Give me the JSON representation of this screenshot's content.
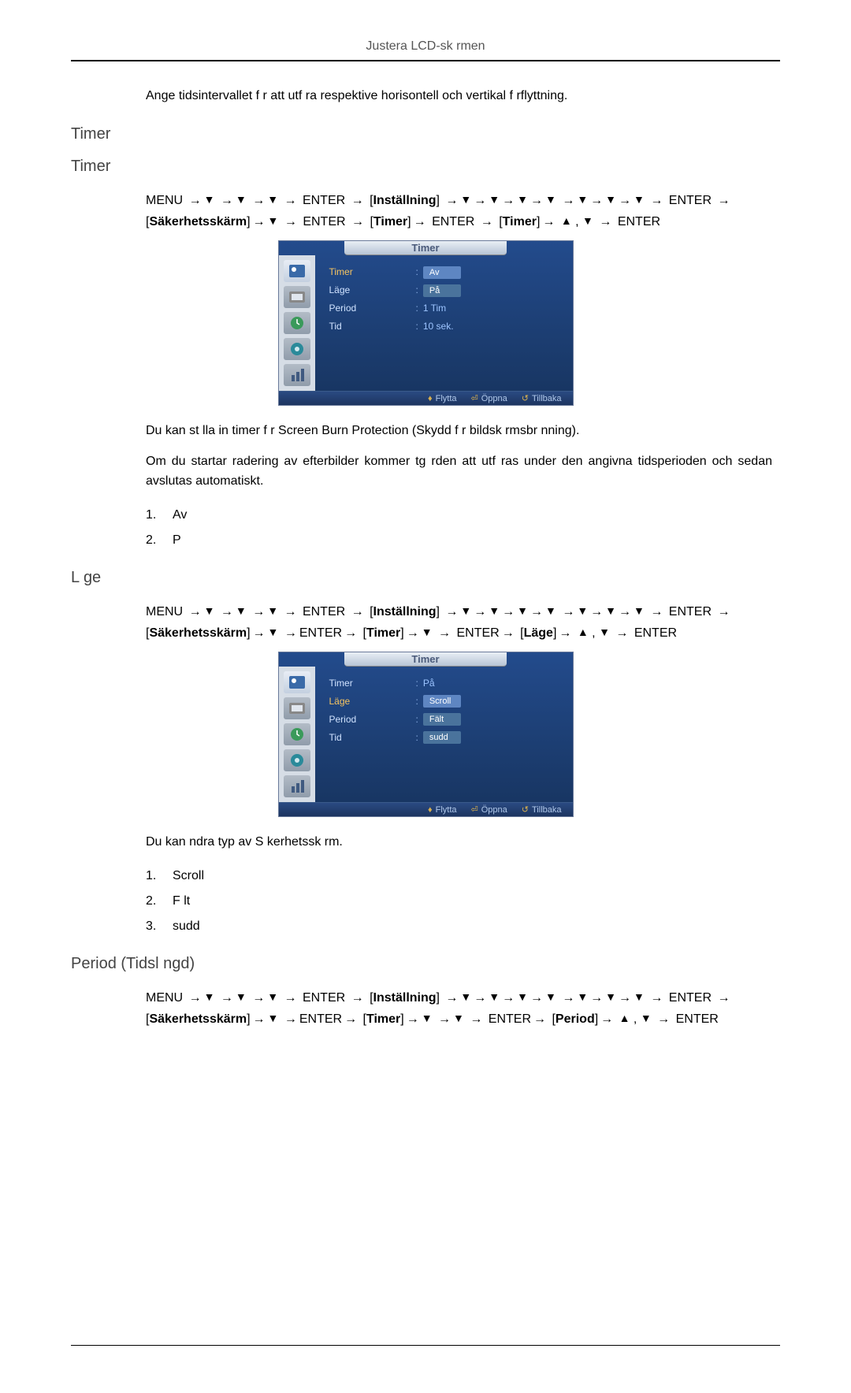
{
  "header": {
    "title": "Justera LCD-sk rmen"
  },
  "intro": "Ange tidsintervallet f r att utf ra respektive horisontell och vertikal f rflyttning.",
  "sections": {
    "timer_outer": "Timer",
    "timer_inner": "Timer",
    "lage": "L ge",
    "period": "Period (Tidsl ngd)"
  },
  "nav": {
    "menu": "MENU",
    "enter": "ENTER",
    "installning": "Inställning",
    "sakerhetsskarm": "Säkerhetsskärm",
    "timer_br": "Timer",
    "lage_br": "Läge",
    "period_br": "Period"
  },
  "osd_timer": {
    "title": "Timer",
    "rows": {
      "timer": "Timer",
      "lage": "Läge",
      "period": "Period",
      "tid": "Tid"
    },
    "vals": {
      "av": "Av",
      "pa": "På",
      "period": "1 Tim",
      "tid": "10 sek."
    },
    "footer": {
      "flytta": "Flytta",
      "oppna": "Öppna",
      "tillbaka": "Tillbaka"
    }
  },
  "osd_lage": {
    "title": "Timer",
    "rows": {
      "timer": "Timer",
      "lage": "Läge",
      "period": "Period",
      "tid": "Tid"
    },
    "vals": {
      "timer": "På",
      "scroll": "Scroll",
      "falt": "Fält",
      "sudd": "sudd"
    },
    "footer": {
      "flytta": "Flytta",
      "oppna": "Öppna",
      "tillbaka": "Tillbaka"
    }
  },
  "text": {
    "timer_desc1": "Du kan st lla in timer f r Screen Burn Protection (Skydd f r bildsk rmsbr nning).",
    "timer_desc2": "Om du startar radering av efterbilder kommer  tg rden att utf ras under den angivna tidsperioden och sedan avslutas automatiskt.",
    "lage_desc": "Du kan  ndra typ av S kerhetssk rm."
  },
  "list_timer": [
    {
      "n": "1.",
      "v": "Av"
    },
    {
      "n": "2.",
      "v": "P"
    }
  ],
  "list_lage": [
    {
      "n": "1.",
      "v": "Scroll"
    },
    {
      "n": "2.",
      "v": "F lt"
    },
    {
      "n": "3.",
      "v": "sudd"
    }
  ]
}
